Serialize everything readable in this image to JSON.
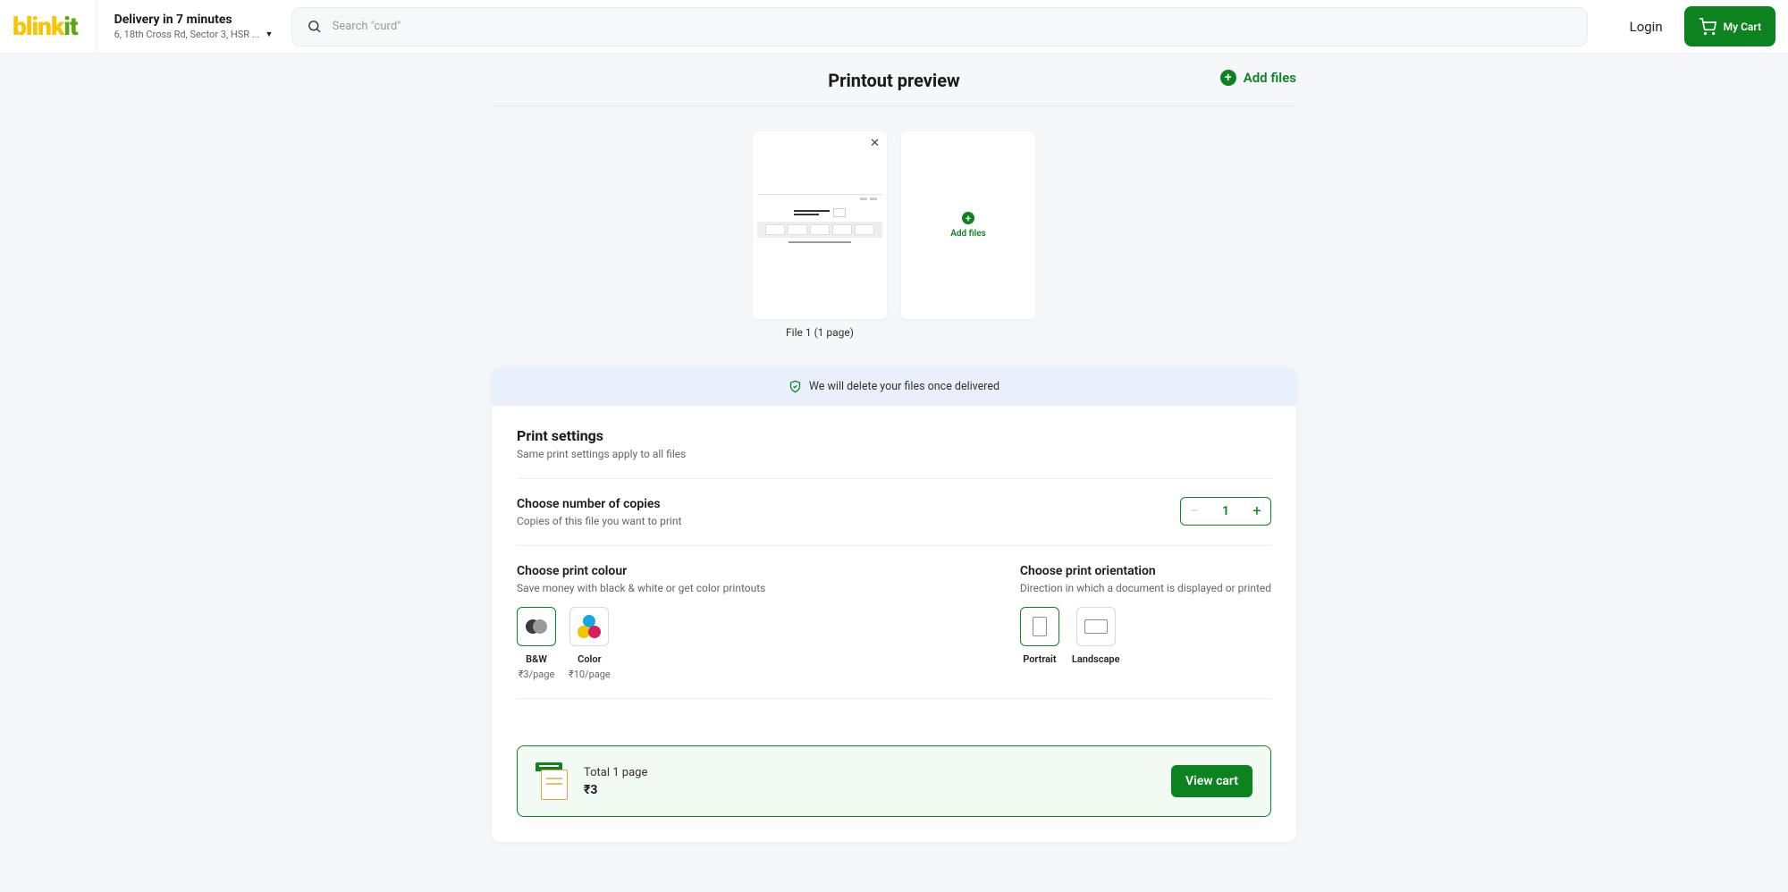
{
  "header": {
    "logo_a": "blink",
    "logo_b": "it",
    "delivery_title": "Delivery in 7 minutes",
    "address": "6, 18th Cross Rd, Sector 3, HSR ...",
    "search_placeholder": "Search \"curd\"",
    "login": "Login",
    "cart": "My Cart"
  },
  "preview": {
    "title": "Printout preview",
    "add_files": "Add files",
    "file_caption": "File 1 (1 page)",
    "add_card_label": "Add files"
  },
  "privacy": "We will delete your files once delivered",
  "settings": {
    "title": "Print settings",
    "sub": "Same print settings apply to all files",
    "copies": {
      "title": "Choose number of copies",
      "sub": "Copies of this file you want to print",
      "value": "1"
    },
    "colour": {
      "title": "Choose print colour",
      "sub": "Save money with black & white or get color printouts",
      "bw_label": "B&W",
      "bw_price": "₹3/page",
      "color_label": "Color",
      "color_price": "₹10/page"
    },
    "orient": {
      "title": "Choose print orientation",
      "sub": "Direction in which a document is displayed or printed",
      "portrait": "Portrait",
      "landscape": "Landscape"
    }
  },
  "summary": {
    "pages": "Total 1 page",
    "price": "₹3",
    "view_cart": "View cart"
  }
}
